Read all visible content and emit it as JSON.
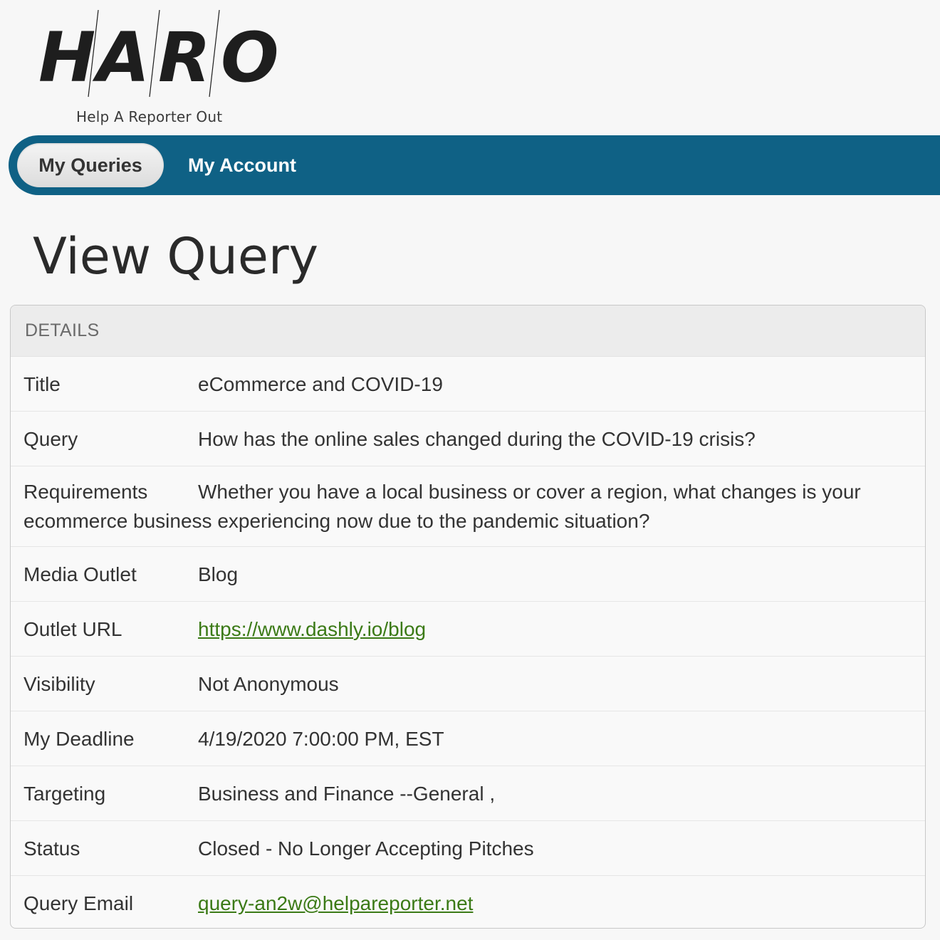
{
  "logo": {
    "wordmark": "HARO",
    "tagline": "Help A Reporter Out"
  },
  "nav": {
    "tabs": [
      {
        "label": "My Queries",
        "active": true
      },
      {
        "label": "My Account",
        "active": false
      }
    ],
    "bar_color": "#0f6185"
  },
  "page": {
    "title": "View Query"
  },
  "details": {
    "header": "DETAILS",
    "rows": [
      {
        "label": "Title",
        "value": "eCommerce and COVID-19"
      },
      {
        "label": "Query",
        "value": "How has the online sales changed during the COVID-19 crisis?"
      },
      {
        "label": "Requirements",
        "value": "Whether you have a local business or cover a region, what changes is your ecommerce business experiencing now due to the pandemic situation?"
      },
      {
        "label": "Media Outlet",
        "value": "Blog"
      },
      {
        "label": "Outlet URL",
        "value": "https://www.dashly.io/blog"
      },
      {
        "label": "Visibility",
        "value": "Not Anonymous"
      },
      {
        "label": "My Deadline",
        "value": "4/19/2020 7:00:00 PM, EST"
      },
      {
        "label": "Targeting",
        "value": "Business and Finance --General ,"
      },
      {
        "label": "Status",
        "value": "Closed - No Longer Accepting Pitches"
      },
      {
        "label": "Query Email",
        "value": "query-an2w@helpareporter.net"
      }
    ]
  },
  "colors": {
    "link": "#3b7a16",
    "background": "#f7f7f7"
  }
}
